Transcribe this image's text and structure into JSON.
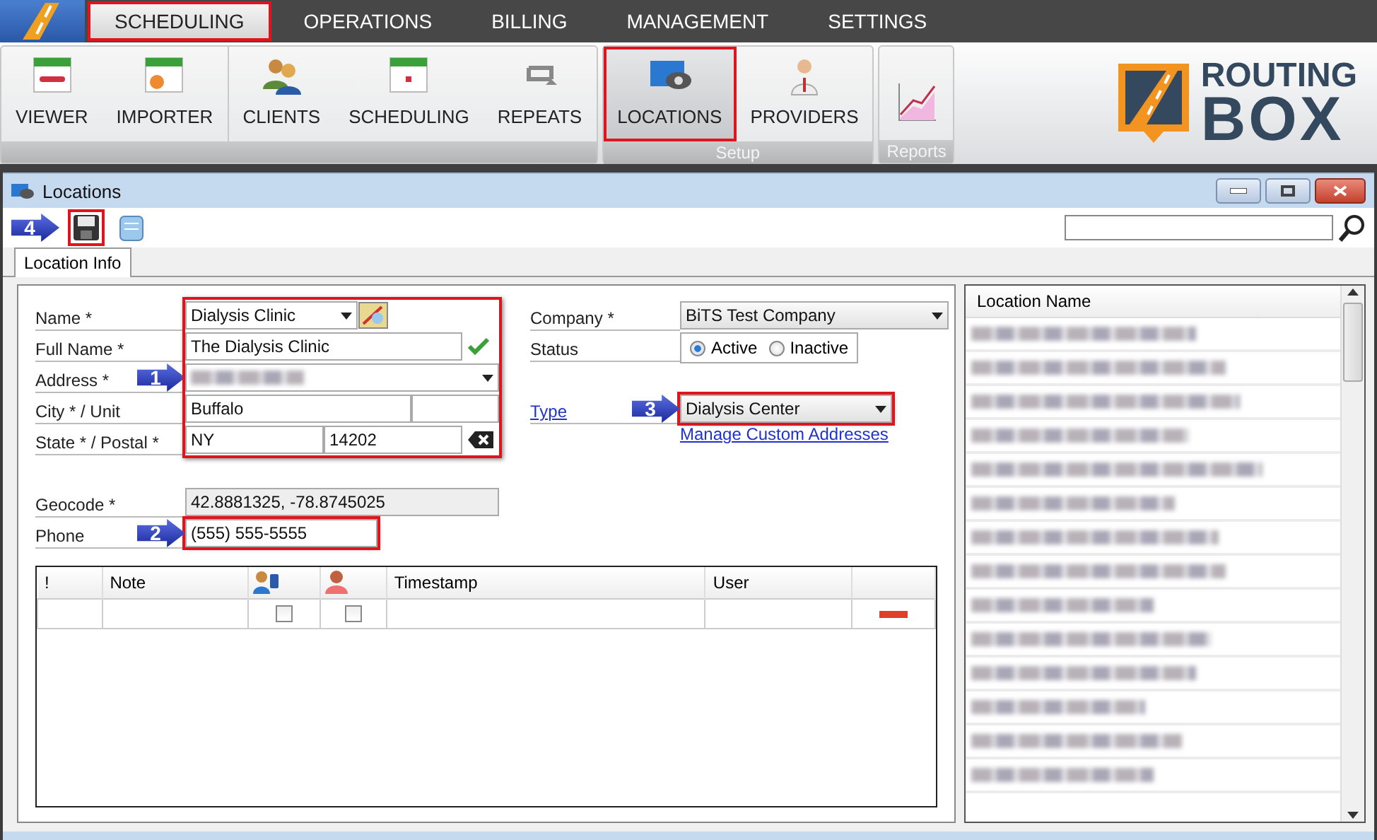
{
  "menu": {
    "items": [
      {
        "label": "SCHEDULING",
        "selected": true,
        "highlighted": true
      },
      {
        "label": "OPERATIONS",
        "selected": false,
        "highlighted": false
      },
      {
        "label": "BILLING",
        "selected": false,
        "highlighted": false
      },
      {
        "label": "MANAGEMENT",
        "selected": false,
        "highlighted": false
      },
      {
        "label": "SETTINGS",
        "selected": false,
        "highlighted": false
      }
    ]
  },
  "ribbon": {
    "groups": [
      {
        "sections": [
          [
            {
              "label": "VIEWER",
              "kind": "viewer",
              "selected": false,
              "highlighted": false
            },
            {
              "label": "IMPORTER",
              "kind": "importer",
              "selected": false,
              "highlighted": false
            }
          ],
          [
            {
              "label": "CLIENTS",
              "kind": "clients",
              "selected": false,
              "highlighted": false
            },
            {
              "label": "SCHEDULING",
              "kind": "scheduling",
              "selected": false,
              "highlighted": false
            },
            {
              "label": "REPEATS",
              "kind": "repeats",
              "selected": false,
              "highlighted": false
            }
          ]
        ]
      },
      {
        "caption": "Setup",
        "sections": [
          [
            {
              "label": "LOCATIONS",
              "kind": "locations",
              "selected": true,
              "highlighted": true
            },
            {
              "label": "PROVIDERS",
              "kind": "providers",
              "selected": false,
              "highlighted": false
            }
          ]
        ]
      },
      {
        "caption": "Reports",
        "sections": [
          [
            {
              "kind": "reports",
              "selected": false,
              "highlighted": false
            }
          ]
        ]
      }
    ]
  },
  "logo": {
    "line1": "ROUTING",
    "line2": "BOX"
  },
  "window": {
    "title": "Locations",
    "toolbar": [
      {
        "kind": "save",
        "highlighted": true,
        "callout": "4"
      },
      {
        "kind": "notes",
        "highlighted": false
      }
    ],
    "tabs": [
      {
        "label": "Location Info",
        "selected": true
      }
    ]
  },
  "form": {
    "address_block": {
      "highlighted": true,
      "callout": "1",
      "name": {
        "label": "Name *",
        "value": "Dialysis Clinic"
      },
      "full_name": {
        "label": "Full Name *",
        "value": "The Dialysis Clinic",
        "verified": true
      },
      "address": {
        "label": "Address *",
        "kind": "redacted"
      },
      "city": {
        "label": "City * / Unit",
        "value": "Buffalo"
      },
      "state": {
        "label": "State * / Postal *",
        "state": "NY",
        "postal": "14202"
      }
    },
    "geocode": {
      "label": "Geocode *",
      "value": "42.8881325, -78.8745025"
    },
    "phone": {
      "label": "Phone",
      "value": "(555) 555-5555",
      "highlighted": true,
      "callout": "2"
    },
    "company": {
      "label": "Company *",
      "value": "BiTS Test Company"
    },
    "status": {
      "label": "Status",
      "options": [
        {
          "label": "Active",
          "selected": true
        },
        {
          "label": "Inactive",
          "selected": false
        }
      ]
    },
    "type": {
      "label": "Type",
      "value": "Dialysis Center",
      "highlighted": true,
      "callout": "3"
    },
    "manage_link": "Manage Custom Addresses"
  },
  "notes": {
    "columns": [
      {
        "kind": "text",
        "label": "!"
      },
      {
        "kind": "text",
        "label": "Note"
      },
      {
        "kind": "contact"
      },
      {
        "kind": "person"
      },
      {
        "kind": "text",
        "label": "Timestamp"
      },
      {
        "kind": "text",
        "label": "User"
      },
      {
        "kind": "blank"
      }
    ],
    "rows": [
      {
        "checkboxes": [
          {
            "checked": false
          },
          {
            "checked": false
          }
        ]
      }
    ]
  },
  "location_list": {
    "header": "Location Name",
    "rows": [
      {
        "kind": "redacted"
      },
      {
        "kind": "redacted"
      },
      {
        "kind": "redacted"
      },
      {
        "kind": "redacted"
      },
      {
        "kind": "redacted"
      },
      {
        "kind": "redacted"
      },
      {
        "kind": "redacted"
      },
      {
        "kind": "redacted"
      },
      {
        "kind": "redacted"
      },
      {
        "kind": "redacted"
      },
      {
        "kind": "redacted"
      },
      {
        "kind": "redacted"
      },
      {
        "kind": "redacted"
      },
      {
        "kind": "redacted"
      }
    ]
  }
}
